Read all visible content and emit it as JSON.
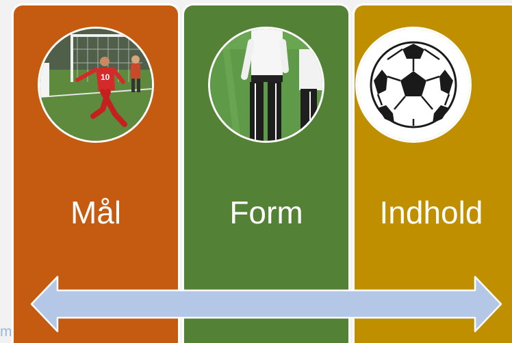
{
  "colors": {
    "panel_1": "#c55a11",
    "panel_2": "#538135",
    "panel_3": "#bf8f00",
    "arrow_fill": "#b4c7e7",
    "border": "#ffffff"
  },
  "panels": [
    {
      "label": "Mål",
      "image": "football-kick-photo"
    },
    {
      "label": "Form",
      "image": "coaches-on-field-photo"
    },
    {
      "label": "Indhold",
      "image": "soccer-ball-icon"
    }
  ],
  "arrow": {
    "direction": "bidirectional",
    "icon": "double-headed-arrow"
  },
  "side_text": "ment"
}
